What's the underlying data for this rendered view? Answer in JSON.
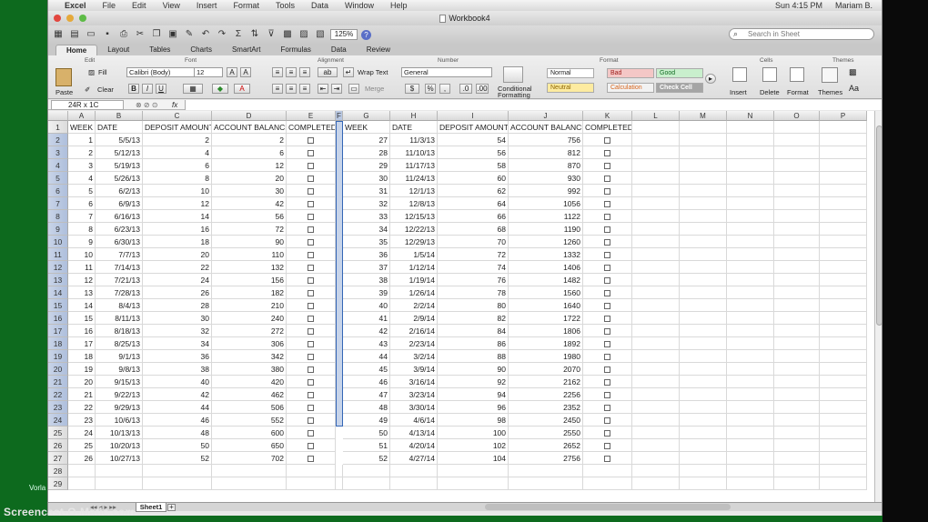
{
  "app": {
    "menu": [
      "Excel",
      "File",
      "Edit",
      "View",
      "Insert",
      "Format",
      "Tools",
      "Data",
      "Window",
      "Help"
    ],
    "status_right": [
      "Sun 4:15 PM",
      "Mariam B."
    ],
    "window_title": "Workbook4",
    "zoom": "125%",
    "search_placeholder": "Search in Sheet"
  },
  "ribbon": {
    "tabs": [
      "Home",
      "Layout",
      "Tables",
      "Charts",
      "SmartArt",
      "Formulas",
      "Data",
      "Review"
    ],
    "groups": [
      "Edit",
      "Font",
      "Alignment",
      "Number",
      "Format",
      "Cells",
      "Themes"
    ],
    "paste": "Paste",
    "fill": "Fill",
    "clear": "Clear",
    "font_name": "Calibri (Body)",
    "font_size": "12",
    "wrap_text": "Wrap Text",
    "merge": "Merge",
    "number_format": "General",
    "conditional_formatting": [
      "Conditional",
      "Formatting"
    ],
    "styles": [
      {
        "label": "Normal",
        "bg": "#ffffff",
        "color": "#222222"
      },
      {
        "label": "Bad",
        "bg": "#f4c7c6",
        "color": "#9c1a17"
      },
      {
        "label": "Good",
        "bg": "#c9efcd",
        "color": "#116b22"
      },
      {
        "label": "Neutral",
        "bg": "#fdeba0",
        "color": "#8c6500"
      },
      {
        "label": "Calculation",
        "bg": "#f2f2f2",
        "color": "#d8651c"
      },
      {
        "label": "Check Cell",
        "bg": "#a5a5a5",
        "color": "#ffffff"
      }
    ],
    "cells_buttons": [
      "Insert",
      "Delete",
      "Format"
    ],
    "themes_button": "Themes"
  },
  "formula_bar": {
    "name_box": "24R x 1C",
    "fx": "fx",
    "value": ""
  },
  "sheet": {
    "columns": [
      "A",
      "B",
      "C",
      "D",
      "E",
      "F",
      "G",
      "H",
      "I",
      "J",
      "K",
      "L",
      "M",
      "N",
      "O",
      "P"
    ],
    "headers_left": [
      "WEEK",
      "DATE",
      "DEPOSIT AMOUNT",
      "ACCOUNT BALANCE",
      "COMPLETED"
    ],
    "headers_right": [
      "WEEK",
      "DATE",
      "DEPOSIT AMOUNT",
      "ACCOUNT BALANCE",
      "COMPLETED"
    ],
    "left_rows": [
      [
        "1",
        "5/5/13",
        "2",
        "2"
      ],
      [
        "2",
        "5/12/13",
        "4",
        "6"
      ],
      [
        "3",
        "5/19/13",
        "6",
        "12"
      ],
      [
        "4",
        "5/26/13",
        "8",
        "20"
      ],
      [
        "5",
        "6/2/13",
        "10",
        "30"
      ],
      [
        "6",
        "6/9/13",
        "12",
        "42"
      ],
      [
        "7",
        "6/16/13",
        "14",
        "56"
      ],
      [
        "8",
        "6/23/13",
        "16",
        "72"
      ],
      [
        "9",
        "6/30/13",
        "18",
        "90"
      ],
      [
        "10",
        "7/7/13",
        "20",
        "110"
      ],
      [
        "11",
        "7/14/13",
        "22",
        "132"
      ],
      [
        "12",
        "7/21/13",
        "24",
        "156"
      ],
      [
        "13",
        "7/28/13",
        "26",
        "182"
      ],
      [
        "14",
        "8/4/13",
        "28",
        "210"
      ],
      [
        "15",
        "8/11/13",
        "30",
        "240"
      ],
      [
        "16",
        "8/18/13",
        "32",
        "272"
      ],
      [
        "17",
        "8/25/13",
        "34",
        "306"
      ],
      [
        "18",
        "9/1/13",
        "36",
        "342"
      ],
      [
        "19",
        "9/8/13",
        "38",
        "380"
      ],
      [
        "20",
        "9/15/13",
        "40",
        "420"
      ],
      [
        "21",
        "9/22/13",
        "42",
        "462"
      ],
      [
        "22",
        "9/29/13",
        "44",
        "506"
      ],
      [
        "23",
        "10/6/13",
        "46",
        "552"
      ],
      [
        "24",
        "10/13/13",
        "48",
        "600"
      ],
      [
        "25",
        "10/20/13",
        "50",
        "650"
      ],
      [
        "26",
        "10/27/13",
        "52",
        "702"
      ]
    ],
    "right_rows": [
      [
        "27",
        "11/3/13",
        "54",
        "756"
      ],
      [
        "28",
        "11/10/13",
        "56",
        "812"
      ],
      [
        "29",
        "11/17/13",
        "58",
        "870"
      ],
      [
        "30",
        "11/24/13",
        "60",
        "930"
      ],
      [
        "31",
        "12/1/13",
        "62",
        "992"
      ],
      [
        "32",
        "12/8/13",
        "64",
        "1056"
      ],
      [
        "33",
        "12/15/13",
        "66",
        "1122"
      ],
      [
        "34",
        "12/22/13",
        "68",
        "1190"
      ],
      [
        "35",
        "12/29/13",
        "70",
        "1260"
      ],
      [
        "36",
        "1/5/14",
        "72",
        "1332"
      ],
      [
        "37",
        "1/12/14",
        "74",
        "1406"
      ],
      [
        "38",
        "1/19/14",
        "76",
        "1482"
      ],
      [
        "39",
        "1/26/14",
        "78",
        "1560"
      ],
      [
        "40",
        "2/2/14",
        "80",
        "1640"
      ],
      [
        "41",
        "2/9/14",
        "82",
        "1722"
      ],
      [
        "42",
        "2/16/14",
        "84",
        "1806"
      ],
      [
        "43",
        "2/23/14",
        "86",
        "1892"
      ],
      [
        "44",
        "3/2/14",
        "88",
        "1980"
      ],
      [
        "45",
        "3/9/14",
        "90",
        "2070"
      ],
      [
        "46",
        "3/16/14",
        "92",
        "2162"
      ],
      [
        "47",
        "3/23/14",
        "94",
        "2256"
      ],
      [
        "48",
        "3/30/14",
        "96",
        "2352"
      ],
      [
        "49",
        "4/6/14",
        "98",
        "2450"
      ],
      [
        "50",
        "4/13/14",
        "100",
        "2550"
      ],
      [
        "51",
        "4/20/14",
        "102",
        "2652"
      ],
      [
        "52",
        "4/27/14",
        "104",
        "2756"
      ]
    ],
    "row_numbers": [
      "1",
      "2",
      "3",
      "4",
      "5",
      "6",
      "7",
      "8",
      "9",
      "10",
      "11",
      "12",
      "13",
      "14",
      "15",
      "16",
      "17",
      "18",
      "19",
      "20",
      "21",
      "22",
      "23",
      "24",
      "25",
      "26",
      "27",
      "28",
      "29"
    ],
    "sheet_tab": "Sheet1",
    "add_tab": "+"
  },
  "overlay": {
    "watermark": "Screencast-O-Matic.com",
    "side_text": "Vorla"
  }
}
